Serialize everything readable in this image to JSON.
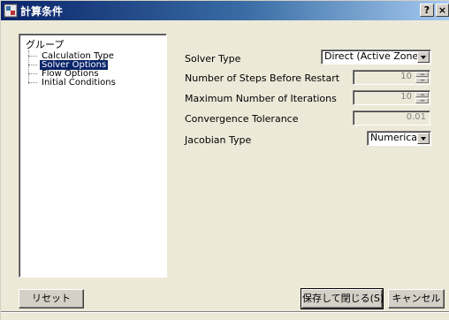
{
  "window": {
    "title": "計算条件",
    "help_button": "?",
    "close_button": "×"
  },
  "tree": {
    "root": "グループ",
    "items": [
      {
        "label": "Calculation Type",
        "selected": false
      },
      {
        "label": "Solver Options",
        "selected": true
      },
      {
        "label": "Flow Options",
        "selected": false
      },
      {
        "label": "Initial Conditions",
        "selected": false
      }
    ]
  },
  "form": {
    "solver_type": {
      "label": "Solver Type",
      "value": "Direct (Active Zone)"
    },
    "steps_before_restart": {
      "label": "Number of Steps Before Restart",
      "value": "10"
    },
    "max_iterations": {
      "label": "Maximum Number of Iterations",
      "value": "10"
    },
    "convergence_tolerance": {
      "label": "Convergence Tolerance",
      "value": "0.01"
    },
    "jacobian_type": {
      "label": "Jacobian Type",
      "value": "Numerical"
    }
  },
  "footer": {
    "reset_label": "リセット",
    "save_close_label": "保存して閉じる(S)",
    "cancel_label": "キャンセル"
  },
  "colors": {
    "titlebar_start": "#0a246a",
    "titlebar_end": "#a6caf0",
    "dialog_bg": "#ece9d8",
    "selection": "#0a246a"
  }
}
